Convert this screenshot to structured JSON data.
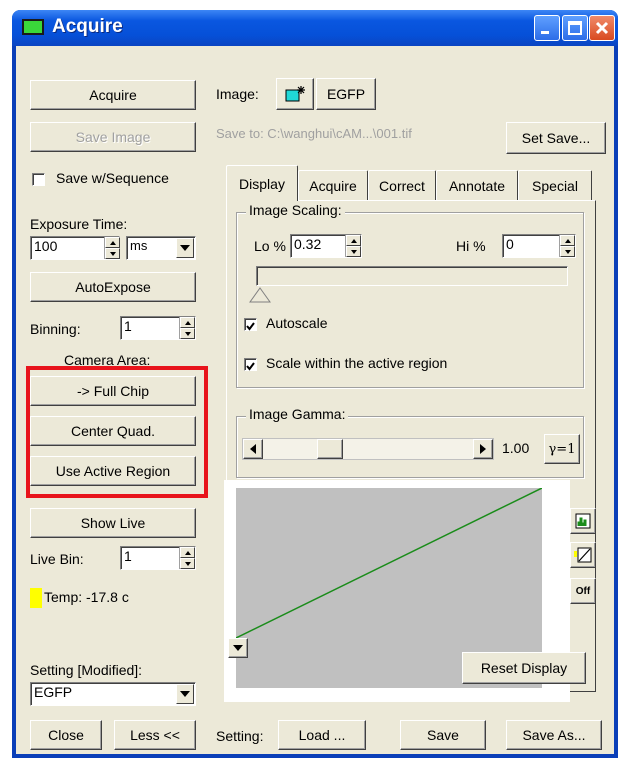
{
  "window": {
    "title": "Acquire"
  },
  "left": {
    "acquire_label": "Acquire",
    "save_image_label": "Save Image",
    "save_sequence_label": "Save w/Sequence",
    "exposure_label": "Exposure Time:",
    "exposure_value": "100",
    "exposure_unit": "ms",
    "autoexpose_label": "AutoExpose",
    "binning_label": "Binning:",
    "binning_value": "1",
    "camera_area_label": "Camera Area:",
    "full_chip_label": "-> Full Chip",
    "center_quad_label": "Center Quad.",
    "use_active_label": "Use Active Region",
    "show_live_label": "Show Live",
    "live_bin_label": "Live Bin:",
    "live_bin_value": "1",
    "temp_label": "Temp: -17.8 c",
    "setting_label": "Setting [Modified]:",
    "setting_value": "EGFP",
    "close_label": "Close",
    "less_label": "Less <<"
  },
  "top": {
    "image_label": "Image:",
    "image_name": "EGFP",
    "save_to": "Save to: C:\\wanghui\\cAM...\\001.tif",
    "set_save_label": "Set Save..."
  },
  "tabs": [
    "Display",
    "Acquire",
    "Correct",
    "Annotate",
    "Special"
  ],
  "display": {
    "scaling_title": "Image Scaling:",
    "lo_label": "Lo %",
    "lo_value": "0.32",
    "hi_label": "Hi %",
    "hi_value": "0",
    "autoscale_label": "Autoscale",
    "scale_active_label": "Scale within the active region",
    "gamma_title": "Image Gamma:",
    "gamma_value": "1.00",
    "gamma_reset_label": "γ=1",
    "off_label": "Off",
    "reset_label": "Reset Display"
  },
  "bottom": {
    "setting_label": "Setting:",
    "load_label": "Load ...",
    "save_label": "Save",
    "save_as_label": "Save As..."
  },
  "colors": {
    "highlight": "#e8141c",
    "temp_indicator": "#ffff00",
    "curve": "#1a8c1a",
    "titlebar": "#0a57e0"
  }
}
